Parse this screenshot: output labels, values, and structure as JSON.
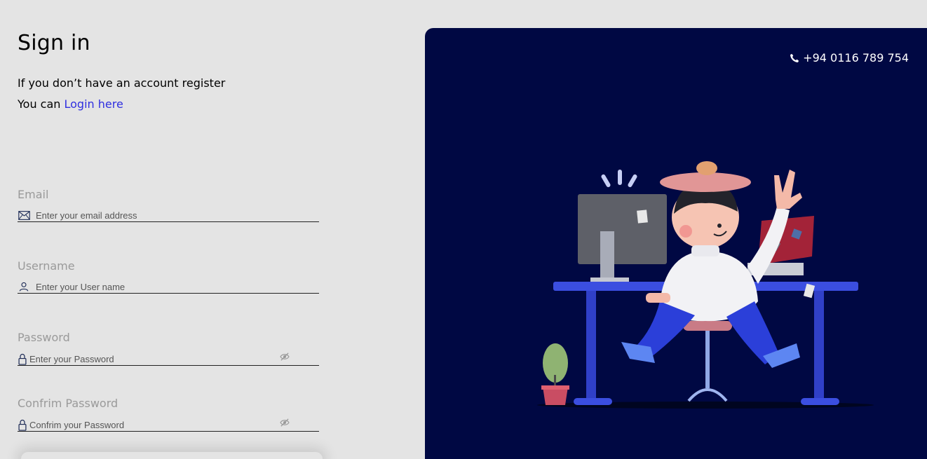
{
  "page": {
    "title": "Sign in",
    "intro_line1": "If you don’t have an account register",
    "intro_line2_prefix": "You can ",
    "intro_link": "Login here"
  },
  "form": {
    "email": {
      "label": "Email",
      "placeholder": "Enter your email address",
      "icon": "envelope-icon"
    },
    "username": {
      "label": "Username",
      "placeholder": "Enter your User name",
      "icon": "user-icon"
    },
    "password": {
      "label": "Password",
      "placeholder": "Enter your Password",
      "icon": "lock-icon",
      "toggle_icon": "eye-slash-icon"
    },
    "confirm_password": {
      "label": "Confrim Password",
      "placeholder": "Confrim your Password",
      "icon": "lock-icon",
      "toggle_icon": "eye-slash-icon"
    }
  },
  "contact": {
    "phone": "+94 0116 789 754",
    "icon": "phone-icon"
  },
  "colors": {
    "panel_bg": "#000843",
    "page_bg": "#e4e4e4",
    "link": "#2f2fe0",
    "label_gray": "#9a9a9a"
  }
}
